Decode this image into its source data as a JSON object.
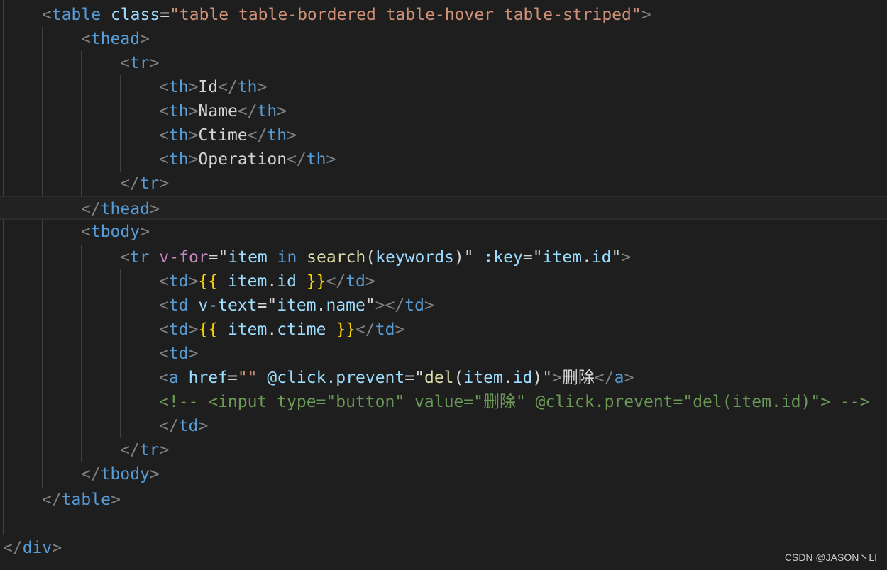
{
  "watermark": "CSDN @JASON丶LI",
  "code": {
    "l1": {
      "p1": "<",
      "tag": "table",
      "attr": " class",
      "eq": "=",
      "val": "\"table table-bordered table-hover table-striped\"",
      "p2": ">"
    },
    "l2": {
      "p1": "<",
      "tag": "thead",
      "p2": ">"
    },
    "l3": {
      "p1": "<",
      "tag": "tr",
      "p2": ">"
    },
    "l4": {
      "p1": "<",
      "tag": "th",
      "p2": ">",
      "text": "Id",
      "p3": "</",
      "tag2": "th",
      "p4": ">"
    },
    "l5": {
      "p1": "<",
      "tag": "th",
      "p2": ">",
      "text": "Name",
      "p3": "</",
      "tag2": "th",
      "p4": ">"
    },
    "l6": {
      "p1": "<",
      "tag": "th",
      "p2": ">",
      "text": "Ctime",
      "p3": "</",
      "tag2": "th",
      "p4": ">"
    },
    "l7": {
      "p1": "<",
      "tag": "th",
      "p2": ">",
      "text": "Operation",
      "p3": "</",
      "tag2": "th",
      "p4": ">"
    },
    "l8": {
      "p1": "</",
      "tag": "tr",
      "p2": ">"
    },
    "l9": {
      "p1": "</",
      "tag": "thead",
      "p2": ">"
    },
    "l10": {
      "p1": "<",
      "tag": "tbody",
      "p2": ">"
    },
    "l11": {
      "p1": "<",
      "tag": "tr",
      "dir": " v-for",
      "eq": "=",
      "q1": "\"",
      "v1": "item",
      "kw": " in",
      "fn": " search",
      "par1": "(",
      "v2": "keywords",
      "par2": ")",
      "q2": "\"",
      "attr": " :key",
      "eq2": "=",
      "q3": "\"",
      "v3": "item",
      "dot": ".",
      "v4": "id",
      "q4": "\"",
      "p2": ">"
    },
    "l12": {
      "p1": "<",
      "tag": "td",
      "p2": ">",
      "b1": "{{",
      "v1": " item",
      "dot": ".",
      "v2": "id",
      "b2": " }}",
      "p3": "</",
      "tag2": "td",
      "p4": ">"
    },
    "l13": {
      "p1": "<",
      "tag": "td",
      "attr": " v-text",
      "eq": "=",
      "q1": "\"",
      "v1": "item",
      "dot": ".",
      "v2": "name",
      "q2": "\"",
      "p2": "></",
      "tag2": "td",
      "p3": ">"
    },
    "l14": {
      "p1": "<",
      "tag": "td",
      "p2": ">",
      "b1": "{{",
      "v1": " item",
      "dot": ".",
      "v2": "ctime",
      "b2": " }}",
      "p3": "</",
      "tag2": "td",
      "p4": ">"
    },
    "l15": {
      "p1": "<",
      "tag": "td",
      "p2": ">"
    },
    "l16": {
      "p1": "<",
      "tag": "a",
      "attr": " href",
      "eq": "=",
      "val": "\"\"",
      "attr2": " @click.prevent",
      "eq2": "=",
      "q1": "\"",
      "fn": "del",
      "par1": "(",
      "v1": "item",
      "dot": ".",
      "v2": "id",
      "par2": ")",
      "q2": "\"",
      "p2": ">",
      "text": "删除",
      "p3": "</",
      "tag2": "a",
      "p4": ">"
    },
    "l17": {
      "comment": "<!-- <input type=\"button\" value=\"删除\" @click.prevent=\"del(item.id)\"> -->"
    },
    "l18": {
      "p1": "</",
      "tag": "td",
      "p2": ">"
    },
    "l19": {
      "p1": "</",
      "tag": "tr",
      "p2": ">"
    },
    "l20": {
      "p1": "</",
      "tag": "tbody",
      "p2": ">"
    },
    "l21": {
      "p1": "</",
      "tag": "table",
      "p2": ">"
    },
    "l23": {
      "p1": "</",
      "tag": "div",
      "p2": ">"
    }
  }
}
